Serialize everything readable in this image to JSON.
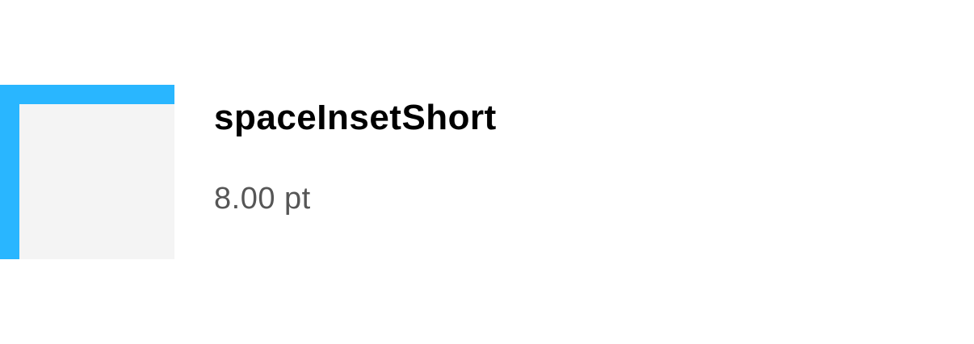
{
  "token": {
    "name": "spaceInsetShort",
    "value": "8.00 pt"
  },
  "colors": {
    "inset_indicator": "#29b6ff",
    "swatch_fill": "#f4f4f4",
    "name_text": "#000000",
    "value_text": "#565656"
  }
}
